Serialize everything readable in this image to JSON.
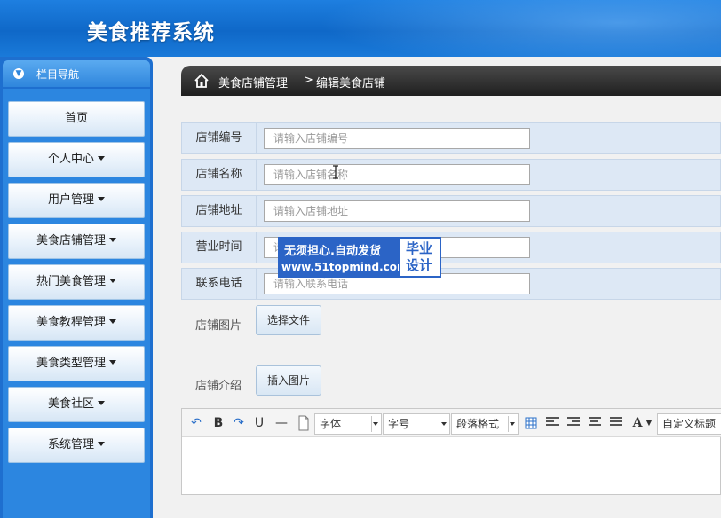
{
  "app": {
    "title": "美食推荐系统"
  },
  "sidebar": {
    "header": "栏目导航",
    "items": [
      {
        "label": "首页",
        "has_dropdown": false
      },
      {
        "label": "个人中心",
        "has_dropdown": true
      },
      {
        "label": "用户管理",
        "has_dropdown": true
      },
      {
        "label": "美食店铺管理",
        "has_dropdown": true
      },
      {
        "label": "热门美食管理",
        "has_dropdown": true
      },
      {
        "label": "美食教程管理",
        "has_dropdown": true
      },
      {
        "label": "美食类型管理",
        "has_dropdown": true
      },
      {
        "label": "美食社区",
        "has_dropdown": true
      },
      {
        "label": "系统管理",
        "has_dropdown": true
      }
    ]
  },
  "breadcrumb": {
    "section": "美食店铺管理",
    "separator": ">",
    "page": "编辑美食店铺"
  },
  "form": {
    "fields": [
      {
        "label": "店铺编号",
        "placeholder": "请输入店铺编号",
        "value": ""
      },
      {
        "label": "店铺名称",
        "placeholder": "请输入店铺名称",
        "value": ""
      },
      {
        "label": "店铺地址",
        "placeholder": "请输入店铺地址",
        "value": ""
      },
      {
        "label": "营业时间",
        "placeholder": "请输入营业时间",
        "value": ""
      },
      {
        "label": "联系电话",
        "placeholder": "请输入联系电话",
        "value": ""
      }
    ],
    "image": {
      "label": "店铺图片",
      "button": "选择文件"
    },
    "intro": {
      "label": "店铺介绍",
      "button": "插入图片"
    }
  },
  "editor": {
    "toolbar": {
      "bold": "B",
      "underline": "U",
      "hr": "—",
      "font_family": "字体",
      "font_size": "字号",
      "paragraph": "段落格式",
      "font_color": "A",
      "custom_title": "自定义标题"
    },
    "content": ""
  },
  "watermark": {
    "line1": "无须担心.自动发货",
    "line2": "www.51topmind.com",
    "badge": "毕业设计"
  },
  "colors": {
    "topbar": "#1a72d8",
    "sidebar": "#1e6fcf",
    "breadcrumb": "#2b2b2b",
    "form_row": "#dde8f5",
    "watermark": "#2b64c6"
  }
}
